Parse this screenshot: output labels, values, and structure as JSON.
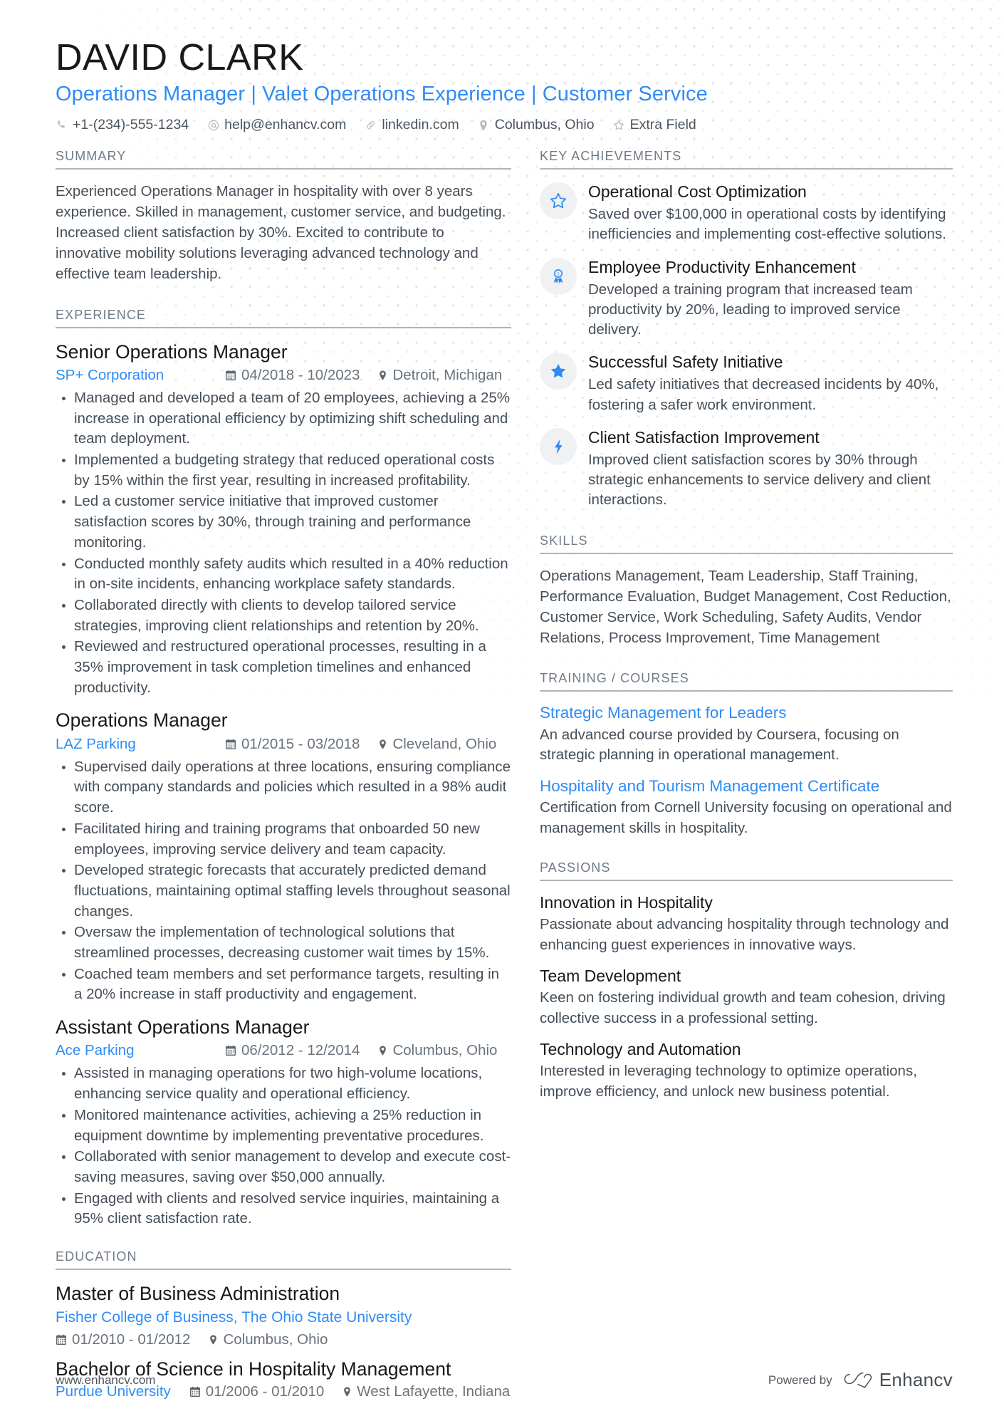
{
  "header": {
    "name": "DAVID CLARK",
    "headline": "Operations Manager | Valet Operations Experience | Customer Service",
    "contacts": [
      {
        "icon": "phone-icon",
        "text": "+1-(234)-555-1234"
      },
      {
        "icon": "email-icon",
        "text": "help@enhancv.com"
      },
      {
        "icon": "link-icon",
        "text": "linkedin.com"
      },
      {
        "icon": "location-icon",
        "text": "Columbus, Ohio"
      },
      {
        "icon": "star-icon",
        "text": "Extra Field"
      }
    ]
  },
  "summary": {
    "title": "SUMMARY",
    "text": "Experienced Operations Manager in hospitality with over 8 years experience. Skilled in management, customer service, and budgeting. Increased client satisfaction by 30%. Excited to contribute to innovative mobility solutions leveraging advanced technology and effective team leadership."
  },
  "experience": {
    "title": "EXPERIENCE",
    "entries": [
      {
        "role": "Senior Operations Manager",
        "company": "SP+ Corporation",
        "dates": "04/2018 - 10/2023",
        "location": "Detroit, Michigan",
        "bullets": [
          "Managed and developed a team of 20 employees, achieving a 25% increase in operational efficiency by optimizing shift scheduling and team deployment.",
          "Implemented a budgeting strategy that reduced operational costs by 15% within the first year, resulting in increased profitability.",
          "Led a customer service initiative that improved customer satisfaction scores by 30%, through training and performance monitoring.",
          "Conducted monthly safety audits which resulted in a 40% reduction in on-site incidents, enhancing workplace safety standards.",
          "Collaborated directly with clients to develop tailored service strategies, improving client relationships and retention by 20%.",
          "Reviewed and restructured operational processes, resulting in a 35% improvement in task completion timelines and enhanced productivity."
        ]
      },
      {
        "role": "Operations Manager",
        "company": "LAZ Parking",
        "dates": "01/2015 - 03/2018",
        "location": "Cleveland, Ohio",
        "bullets": [
          "Supervised daily operations at three locations, ensuring compliance with company standards and policies which resulted in a 98% audit score.",
          "Facilitated hiring and training programs that onboarded 50 new employees, improving service delivery and team capacity.",
          "Developed strategic forecasts that accurately predicted demand fluctuations, maintaining optimal staffing levels throughout seasonal changes.",
          "Oversaw the implementation of technological solutions that streamlined processes, decreasing customer wait times by 15%.",
          "Coached team members and set performance targets, resulting in a 20% increase in staff productivity and engagement."
        ]
      },
      {
        "role": "Assistant Operations Manager",
        "company": "Ace Parking",
        "dates": "06/2012 - 12/2014",
        "location": "Columbus, Ohio",
        "bullets": [
          "Assisted in managing operations for two high-volume locations, enhancing service quality and operational efficiency.",
          "Monitored maintenance activities, achieving a 25% reduction in equipment downtime by implementing preventative procedures.",
          "Collaborated with senior management to develop and execute cost-saving measures, saving over $50,000 annually.",
          "Engaged with clients and resolved service inquiries, maintaining a 95% client satisfaction rate."
        ]
      }
    ]
  },
  "education": {
    "title": "EDUCATION",
    "entries": [
      {
        "degree": "Master of Business Administration",
        "school": "Fisher College of Business, The Ohio State University",
        "dates": "01/2010 - 01/2012",
        "location": "Columbus, Ohio",
        "inline": false
      },
      {
        "degree": "Bachelor of Science in Hospitality Management",
        "school": "Purdue University",
        "dates": "01/2006 - 01/2010",
        "location": "West Lafayette, Indiana",
        "inline": true
      }
    ]
  },
  "key_achievements": {
    "title": "KEY ACHIEVEMENTS",
    "items": [
      {
        "icon": "star-outline-icon",
        "title": "Operational Cost Optimization",
        "desc": "Saved over $100,000 in operational costs by identifying inefficiencies and implementing cost-effective solutions."
      },
      {
        "icon": "medal-icon",
        "title": "Employee Productivity Enhancement",
        "desc": "Developed a training program that increased team productivity by 20%, leading to improved service delivery."
      },
      {
        "icon": "star-filled-icon",
        "title": "Successful Safety Initiative",
        "desc": "Led safety initiatives that decreased incidents by 40%, fostering a safer work environment."
      },
      {
        "icon": "lightning-bolt-icon",
        "title": "Client Satisfaction Improvement",
        "desc": "Improved client satisfaction scores by 30% through strategic enhancements to service delivery and client interactions."
      }
    ]
  },
  "skills": {
    "title": "SKILLS",
    "text": "Operations Management, Team Leadership, Staff Training, Performance Evaluation, Budget Management, Cost Reduction, Customer Service, Work Scheduling, Safety Audits, Vendor Relations, Process Improvement, Time Management"
  },
  "training": {
    "title": "TRAINING / COURSES",
    "entries": [
      {
        "name": "Strategic Management for Leaders",
        "desc": "An advanced course provided by Coursera, focusing on strategic planning in operational management."
      },
      {
        "name": "Hospitality and Tourism Management Certificate",
        "desc": "Certification from Cornell University focusing on operational and management skills in hospitality."
      }
    ]
  },
  "passions": {
    "title": "PASSIONS",
    "entries": [
      {
        "name": "Innovation in Hospitality",
        "desc": "Passionate about advancing hospitality through technology and enhancing guest experiences in innovative ways."
      },
      {
        "name": "Team Development",
        "desc": "Keen on fostering individual growth and team cohesion, driving collective success in a professional setting."
      },
      {
        "name": "Technology and Automation",
        "desc": "Interested in leveraging technology to optimize operations, improve efficiency, and unlock new business potential."
      }
    ]
  },
  "footer": {
    "url": "www.enhancv.com",
    "powered_by": "Powered by",
    "brand": "Enhancv"
  },
  "colors": {
    "accent": "#2f8cf5",
    "heading": "#16181a",
    "body": "#454f59",
    "muted": "#707b86",
    "rule": "#aeb4bb",
    "badge_bg": "#f0f1f2"
  }
}
